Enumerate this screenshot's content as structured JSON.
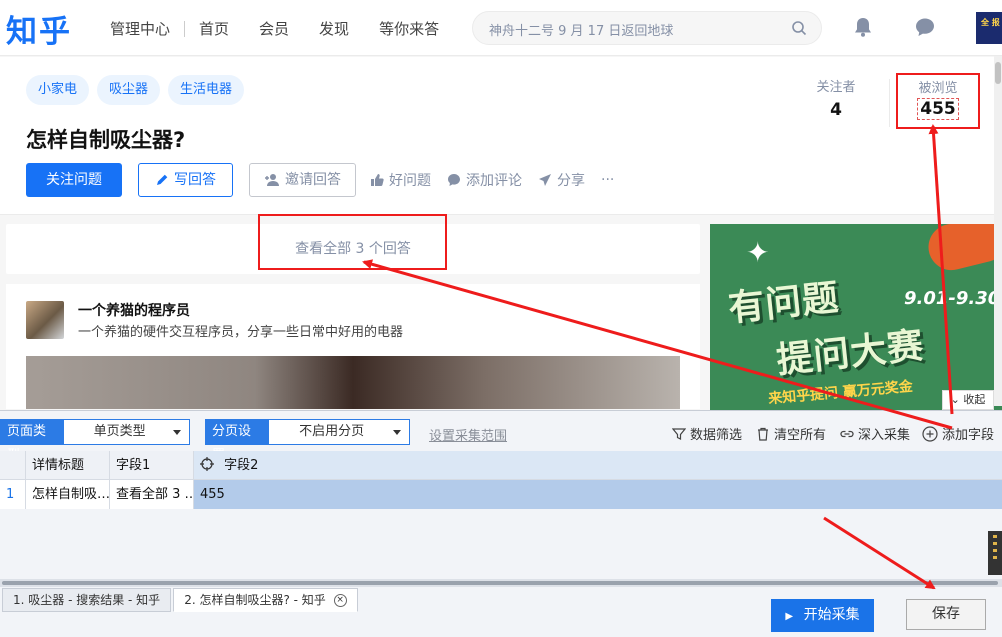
{
  "topnav": {
    "logo": "知乎",
    "links": [
      "管理中心",
      "首页",
      "会员",
      "发现",
      "等你来答"
    ],
    "search_text": "神舟十二号 9 月 17 日返回地球",
    "corner_badge": "全\n报"
  },
  "question": {
    "tags": [
      "小家电",
      "吸尘器",
      "生活电器"
    ],
    "title": "怎样自制吸尘器?",
    "followers_label": "关注者",
    "followers_value": "4",
    "views_label": "被浏览",
    "views_value": "455",
    "actions": {
      "follow": "关注问题",
      "write": "写回答",
      "invite": "邀请回答",
      "good": "好问题",
      "comment": "添加评论",
      "share": "分享",
      "more": "···"
    }
  },
  "content": {
    "view_all": "查看全部 3 个回答",
    "author_name": "一个养猫的程序员",
    "author_desc": "一个养猫的硬件交互程序员，分享一些日常中好用的电器"
  },
  "banner": {
    "line1": "有问题",
    "line2": "提问大赛",
    "date": "9.01-9.30",
    "sub": "来知乎提问 赢万元奖金",
    "collapse": "收起"
  },
  "scraper": {
    "page_type_label": "页面类型",
    "page_type_value": "单页类型",
    "paging_label": "分页设置",
    "paging_value": "不启用分页",
    "range_link": "设置采集范围",
    "tools": [
      "数据筛选",
      "清空所有",
      "深入采集",
      "添加字段"
    ],
    "columns": [
      "",
      "详情标题",
      "字段1",
      "字段2"
    ],
    "rows": [
      [
        "1",
        "怎样自制吸…",
        "查看全部 3 …",
        "455"
      ]
    ],
    "tabs": [
      "1. 吸尘器 - 搜索结果 - 知乎",
      "2. 怎样自制吸尘器? - 知乎"
    ],
    "start_button": "开始采集",
    "save_button": "保存"
  },
  "colors": {
    "brand": "#1772f6",
    "annotation_red": "#ee1c1c",
    "banner_green": "#3b8a56"
  }
}
